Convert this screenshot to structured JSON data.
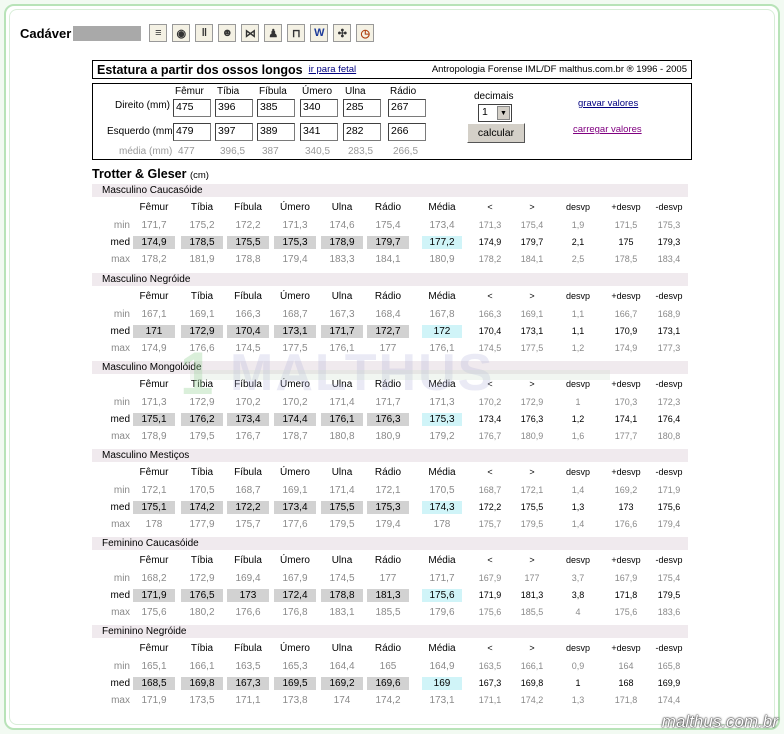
{
  "topbar": {
    "label": "Cadáver",
    "icons": [
      "form-icon",
      "camera-icon",
      "bones-icon",
      "skull-icon",
      "butterfly-icon",
      "people-icon",
      "lock-icon",
      "word-icon",
      "tool-icon",
      "clock-icon"
    ]
  },
  "title": {
    "text": "Estatura a partir dos ossos longos",
    "link": "ir para fetal",
    "right": "Antropologia Forense IML/DF  malthus.com.br ® 1996 - 2005"
  },
  "input": {
    "headers": [
      "Fêmur",
      "Tíbia",
      "Fíbula",
      "Úmero",
      "Ulna",
      "Rádio"
    ],
    "direito_label": "Direito (mm)",
    "esquerdo_label": "Esquerdo (mm)",
    "direito": [
      "475",
      "396",
      "385",
      "340",
      "285",
      "267"
    ],
    "esquerdo": [
      "479",
      "397",
      "389",
      "341",
      "282",
      "266"
    ],
    "media_label": "média (mm)",
    "media": [
      "477",
      "396,5",
      "387",
      "340,5",
      "283,5",
      "266,5"
    ],
    "decimais_label": "decimais",
    "decimais_value": "1",
    "calc_label": "calcular",
    "gravar_label": "gravar valores",
    "carregar_label": "carregar valores"
  },
  "tg": {
    "title": "Trotter & Gleser",
    "unit": "(cm)"
  },
  "columns": [
    "Fêmur",
    "Tíbia",
    "Fíbula",
    "Úmero",
    "Ulna",
    "Rádio",
    "Média",
    "<",
    ">",
    "desvp",
    "+desvp",
    "-desvp"
  ],
  "row_labels": [
    "min",
    "med",
    "max"
  ],
  "sections": [
    {
      "name": "Masculino Caucasóide",
      "min": [
        "171,7",
        "175,2",
        "172,2",
        "171,3",
        "174,6",
        "175,4",
        "173,4",
        "171,3",
        "175,4",
        "1,9",
        "171,5",
        "175,3"
      ],
      "med": [
        "174,9",
        "178,5",
        "175,5",
        "175,3",
        "178,9",
        "179,7",
        "177,2",
        "174,9",
        "179,7",
        "2,1",
        "175",
        "179,3"
      ],
      "max": [
        "178,2",
        "181,9",
        "178,8",
        "179,4",
        "183,3",
        "184,1",
        "180,9",
        "178,2",
        "184,1",
        "2,5",
        "178,5",
        "183,4"
      ]
    },
    {
      "name": "Masculino Negróide",
      "min": [
        "167,1",
        "169,1",
        "166,3",
        "168,7",
        "167,3",
        "168,4",
        "167,8",
        "166,3",
        "169,1",
        "1,1",
        "166,7",
        "168,9"
      ],
      "med": [
        "171",
        "172,9",
        "170,4",
        "173,1",
        "171,7",
        "172,7",
        "172",
        "170,4",
        "173,1",
        "1,1",
        "170,9",
        "173,1"
      ],
      "max": [
        "174,9",
        "176,6",
        "174,5",
        "177,5",
        "176,1",
        "177",
        "176,1",
        "174,5",
        "177,5",
        "1,2",
        "174,9",
        "177,3"
      ]
    },
    {
      "name": "Masculino Mongolóide",
      "min": [
        "171,3",
        "172,9",
        "170,2",
        "170,2",
        "171,4",
        "171,7",
        "171,3",
        "170,2",
        "172,9",
        "1",
        "170,3",
        "172,3"
      ],
      "med": [
        "175,1",
        "176,2",
        "173,4",
        "174,4",
        "176,1",
        "176,3",
        "175,3",
        "173,4",
        "176,3",
        "1,2",
        "174,1",
        "176,4"
      ],
      "max": [
        "178,9",
        "179,5",
        "176,7",
        "178,7",
        "180,8",
        "180,9",
        "179,2",
        "176,7",
        "180,9",
        "1,6",
        "177,7",
        "180,8"
      ]
    },
    {
      "name": "Masculino Mestiços",
      "min": [
        "172,1",
        "170,5",
        "168,7",
        "169,1",
        "171,4",
        "172,1",
        "170,5",
        "168,7",
        "172,1",
        "1,4",
        "169,2",
        "171,9"
      ],
      "med": [
        "175,1",
        "174,2",
        "172,2",
        "173,4",
        "175,5",
        "175,3",
        "174,3",
        "172,2",
        "175,5",
        "1,3",
        "173",
        "175,6"
      ],
      "max": [
        "178",
        "177,9",
        "175,7",
        "177,6",
        "179,5",
        "179,4",
        "178",
        "175,7",
        "179,5",
        "1,4",
        "176,6",
        "179,4"
      ]
    },
    {
      "name": "Feminino Caucasóide",
      "min": [
        "168,2",
        "172,9",
        "169,4",
        "167,9",
        "174,5",
        "177",
        "171,7",
        "167,9",
        "177",
        "3,7",
        "167,9",
        "175,4"
      ],
      "med": [
        "171,9",
        "176,5",
        "173",
        "172,4",
        "178,8",
        "181,3",
        "175,6",
        "171,9",
        "181,3",
        "3,8",
        "171,8",
        "179,5"
      ],
      "max": [
        "175,6",
        "180,2",
        "176,6",
        "176,8",
        "183,1",
        "185,5",
        "179,6",
        "175,6",
        "185,5",
        "4",
        "175,6",
        "183,6"
      ]
    },
    {
      "name": "Feminino Negróide",
      "min": [
        "165,1",
        "166,1",
        "163,5",
        "165,3",
        "164,4",
        "165",
        "164,9",
        "163,5",
        "166,1",
        "0,9",
        "164",
        "165,8"
      ],
      "med": [
        "168,5",
        "169,8",
        "167,3",
        "169,5",
        "169,2",
        "169,6",
        "169",
        "167,3",
        "169,8",
        "1",
        "168",
        "169,9"
      ],
      "max": [
        "171,9",
        "173,5",
        "171,1",
        "173,8",
        "174",
        "174,2",
        "173,1",
        "171,1",
        "174,2",
        "1,3",
        "171,8",
        "174,4"
      ]
    }
  ],
  "watermark": {
    "text": "MALTHUS"
  },
  "signature": "malthus.com.br",
  "colors": {
    "gray_cell": "#d2d2d2",
    "cyan_cell": "#d0f4f8",
    "section_bg": "#f0eaee",
    "frame": "#b8e3b8"
  }
}
